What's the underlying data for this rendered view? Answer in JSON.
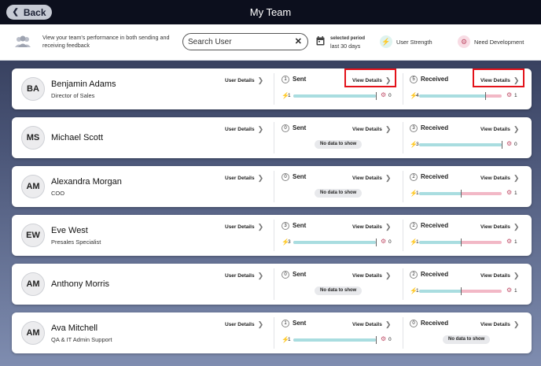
{
  "header": {
    "title": "My Team",
    "back_label": "Back"
  },
  "toolbar": {
    "description": "View your team's performance in both sending and receiving feedback",
    "search_value": "Search User",
    "period_label": "selected period",
    "period_value": "last 30 days",
    "legend": [
      {
        "label": "User Strength",
        "icon": "bolt-icon",
        "color": "#2a9d8f"
      },
      {
        "label": "Need Development",
        "icon": "gear-icon",
        "color": "#c0506a"
      }
    ]
  },
  "labels": {
    "user_details": "User Details",
    "view_details": "View Details",
    "sent": "Sent",
    "received": "Received",
    "no_data": "No data to show"
  },
  "colors": {
    "strength": "#a9dde0",
    "development": "#f2b8c6",
    "highlight": "#e3121a"
  },
  "members": [
    {
      "initials": "BA",
      "name": "Benjamin Adams",
      "role": "Director of Sales",
      "sent": {
        "count": "1",
        "strength": "1",
        "development": "0",
        "strength_ratio": 1.0,
        "no_data": false
      },
      "received": {
        "count": "5",
        "strength": "4",
        "development": "1",
        "strength_ratio": 0.8,
        "no_data": false
      }
    },
    {
      "initials": "MS",
      "name": "Michael Scott",
      "role": "",
      "sent": {
        "count": "0",
        "strength": "",
        "development": "",
        "strength_ratio": 0,
        "no_data": true
      },
      "received": {
        "count": "3",
        "strength": "3",
        "development": "0",
        "strength_ratio": 1.0,
        "no_data": false
      }
    },
    {
      "initials": "AM",
      "name": "Alexandra Morgan",
      "role": "COO",
      "sent": {
        "count": "0",
        "strength": "",
        "development": "",
        "strength_ratio": 0,
        "no_data": true
      },
      "received": {
        "count": "2",
        "strength": "1",
        "development": "1",
        "strength_ratio": 0.5,
        "no_data": false
      }
    },
    {
      "initials": "EW",
      "name": "Eve West",
      "role": "Presales Specialist",
      "sent": {
        "count": "3",
        "strength": "3",
        "development": "0",
        "strength_ratio": 1.0,
        "no_data": false
      },
      "received": {
        "count": "2",
        "strength": "1",
        "development": "1",
        "strength_ratio": 0.5,
        "no_data": false
      }
    },
    {
      "initials": "AM",
      "name": "Anthony Morris",
      "role": "",
      "sent": {
        "count": "0",
        "strength": "",
        "development": "",
        "strength_ratio": 0,
        "no_data": true
      },
      "received": {
        "count": "2",
        "strength": "1",
        "development": "1",
        "strength_ratio": 0.5,
        "no_data": false
      }
    },
    {
      "initials": "AM",
      "name": "Ava Mitchell",
      "role": "QA & IT Admin Support",
      "sent": {
        "count": "1",
        "strength": "1",
        "development": "0",
        "strength_ratio": 1.0,
        "no_data": false
      },
      "received": {
        "count": "0",
        "strength": "",
        "development": "",
        "strength_ratio": 0,
        "no_data": true
      }
    }
  ]
}
